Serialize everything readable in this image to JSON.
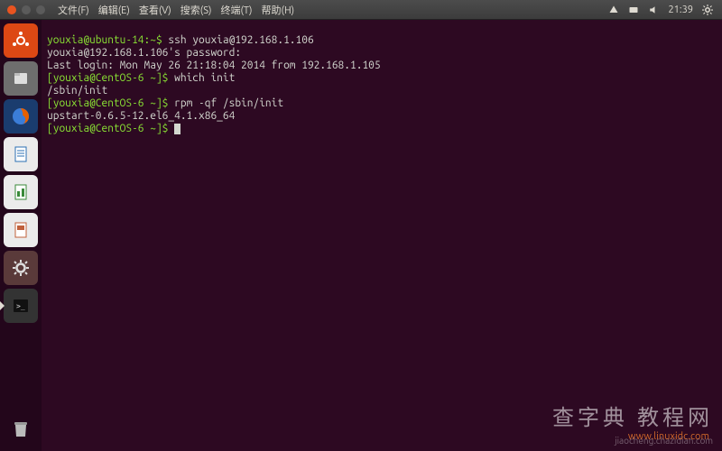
{
  "topbar": {
    "menus": [
      "文件(F)",
      "编辑(E)",
      "查看(V)",
      "搜索(S)",
      "终端(T)",
      "帮助(H)"
    ],
    "clock": "21:39"
  },
  "launcher": {
    "items": [
      {
        "name": "dash",
        "bg": "#dd4814",
        "glyph": "◌"
      },
      {
        "name": "files",
        "bg": "#6e6e6e",
        "glyph": "🗂"
      },
      {
        "name": "firefox",
        "bg": "#2b5797",
        "glyph": "🦊"
      },
      {
        "name": "writer",
        "bg": "#2b6fb3",
        "glyph": "📄"
      },
      {
        "name": "calc",
        "bg": "#3a8a3a",
        "glyph": "📊"
      },
      {
        "name": "impress",
        "bg": "#c0603b",
        "glyph": "📑"
      },
      {
        "name": "software",
        "bg": "#b04040",
        "glyph": "⚙"
      },
      {
        "name": "terminal",
        "bg": "#333333",
        "glyph": ">_",
        "active": true
      }
    ],
    "trash": {
      "name": "trash",
      "glyph": "🗑"
    }
  },
  "terminal": {
    "prompt_local": "youxia@ubuntu-14:~$",
    "cmd1": " ssh youxia@192.168.1.106",
    "pwline": "youxia@192.168.1.106's password:",
    "lastlogin": "Last login: Mon May 26 21:18:04 2014 from 192.168.1.105",
    "prompt_remote": "[youxia@CentOS-6 ~]$",
    "cmd2": " which init",
    "out2": "/sbin/init",
    "cmd3": " rpm -qf /sbin/init",
    "out3": "upstart-0.6.5-12.el6_4.1.x86_64",
    "cmd4": " "
  },
  "watermark": {
    "big": "查字典 教程网",
    "small": "jiaocheng.chazidian.com",
    "orange": "www.linuxidc.com"
  }
}
